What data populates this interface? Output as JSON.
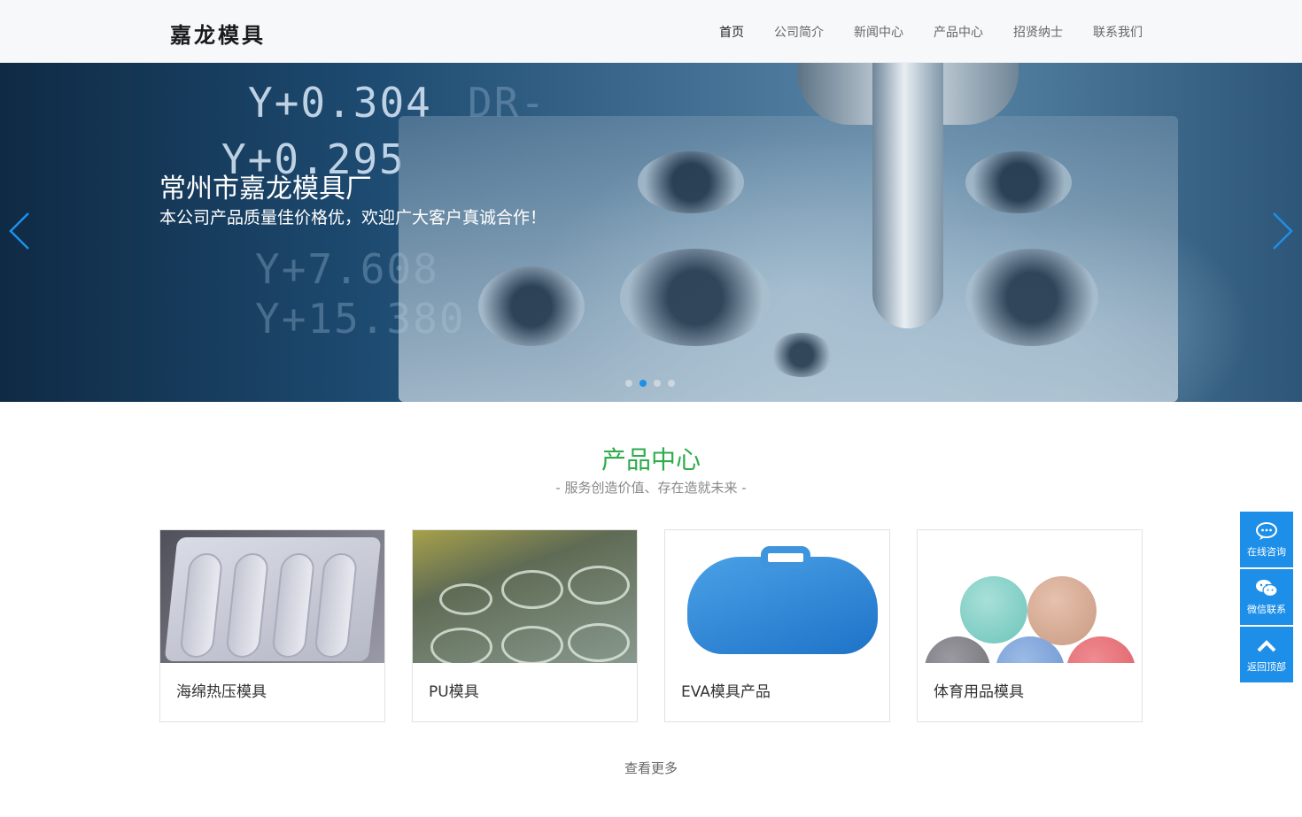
{
  "header": {
    "logo_text": "嘉龙模具",
    "nav": [
      {
        "label": "首页",
        "active": true
      },
      {
        "label": "公司简介"
      },
      {
        "label": "新闻中心"
      },
      {
        "label": "产品中心"
      },
      {
        "label": "招贤纳士"
      },
      {
        "label": "联系我们"
      }
    ]
  },
  "banner": {
    "title": "常州市嘉龙模具厂",
    "subtitle": "本公司产品质量佳价格优，欢迎广大客户真诚合作！",
    "readouts": [
      "Y+0.304",
      "DR-",
      "Y+0.295",
      "Y+7.608",
      "Y+15.380"
    ],
    "prev_icon": "chevron-left-icon",
    "next_icon": "chevron-right-icon",
    "slide_count": 4,
    "active_slide": 2
  },
  "products": {
    "title": "产品中心",
    "subtitle": "- 服务创造价值、存在造就未来 -",
    "items": [
      {
        "name": "海绵热压模具"
      },
      {
        "name": "PU模具"
      },
      {
        "name": "EVA模具产品"
      },
      {
        "name": "体育用品模具"
      }
    ],
    "more_label": "查看更多"
  },
  "side_tools": [
    {
      "label": "在线咨询",
      "icon": "chat-bubble-icon"
    },
    {
      "label": "微信联系",
      "icon": "wechat-icon"
    },
    {
      "label": "返回顶部",
      "icon": "chevron-up-icon"
    }
  ],
  "colors": {
    "accent_blue": "#1e8fe8",
    "title_green": "#2eab4a"
  }
}
